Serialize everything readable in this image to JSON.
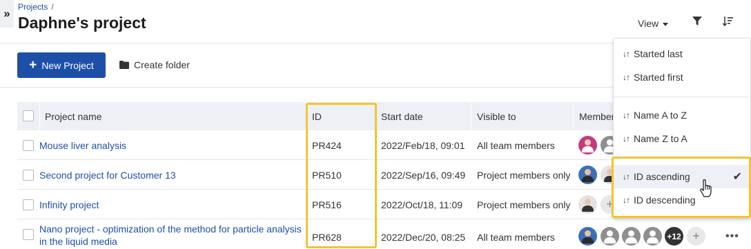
{
  "breadcrumb": {
    "root": "Projects",
    "separator": "/"
  },
  "page_title": "Daphne's project",
  "toolbar": {
    "view_label": "View",
    "new_project_label": "New Project",
    "create_folder_label": "Create folder"
  },
  "table": {
    "columns": [
      "Project name",
      "ID",
      "Start date",
      "Visible to",
      "Member"
    ],
    "rows": [
      {
        "name": "Mouse liver analysis",
        "id": "PR424",
        "start": "2022/Feb/18, 09:01",
        "visible": "All team members"
      },
      {
        "name": "Second project for Customer 13",
        "id": "PR510",
        "start": "2022/Sep/16, 09:49",
        "visible": "Project members only"
      },
      {
        "name": "Infinity project",
        "id": "PR516",
        "start": "2022/Oct/18, 11:09",
        "visible": "Project members only"
      },
      {
        "name_line1": "Nano project - optimization of the method for particle analysis",
        "name_line2": "in the liquid media",
        "id": "PR628",
        "start": "2022/Dec/20, 08:25",
        "visible": "All team members",
        "more_members": "+12"
      }
    ]
  },
  "sort_menu": {
    "items": [
      "Started last",
      "Started first",
      "Name A to Z",
      "Name Z to A",
      "ID ascending",
      "ID descending"
    ],
    "selected": "ID ascending"
  },
  "colors": {
    "accent": "#1d4fa8",
    "highlight": "#f4c430"
  },
  "icons": [
    "expand-icon",
    "filter-icon",
    "sort-icon",
    "folder-icon",
    "plus-icon",
    "check-icon",
    "more-icon",
    "pointer-cursor-icon"
  ]
}
